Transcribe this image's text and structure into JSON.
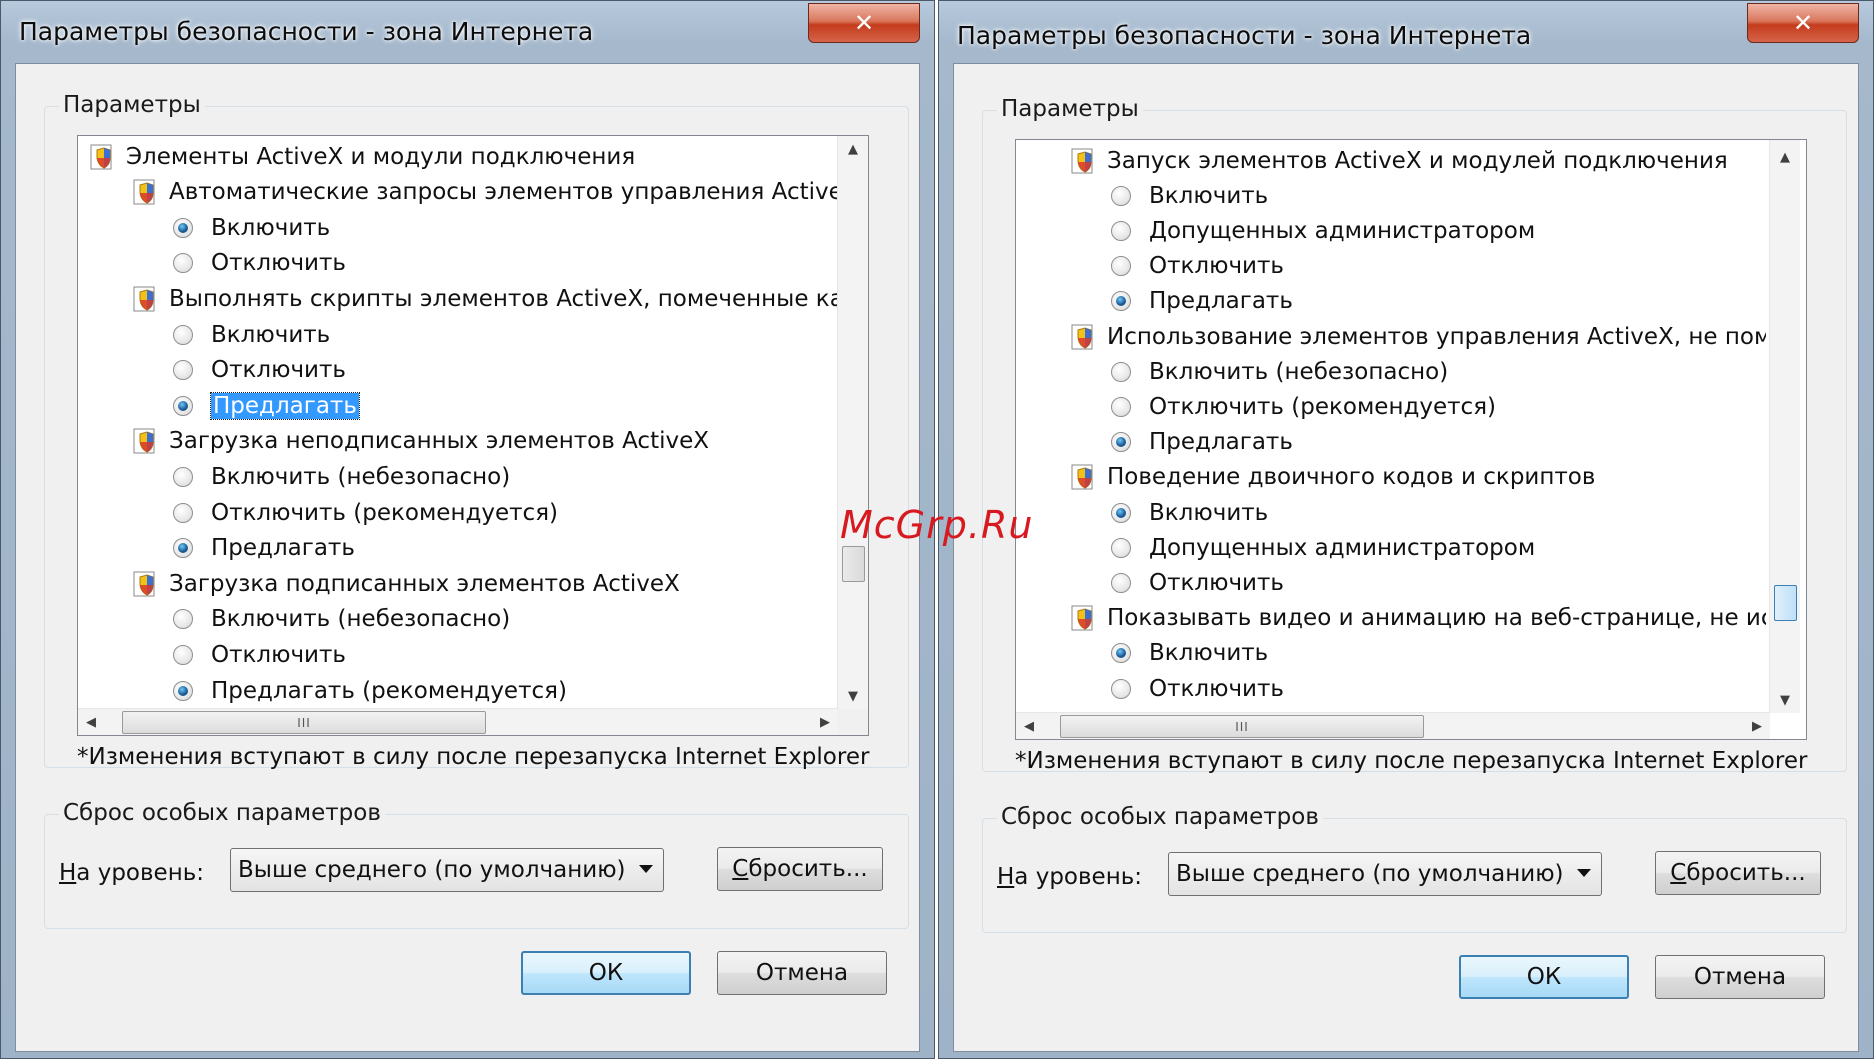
{
  "watermark": "McGrp.Ru",
  "dialogs": [
    {
      "title": "Параметры безопасности - зона Интернета",
      "close_label": "✕",
      "group_label": "Параметры",
      "tree_items": [
        {
          "kind": "header",
          "label": "Элементы ActiveX и модули подключения",
          "level": 0
        },
        {
          "kind": "header",
          "label": "Автоматические запросы элементов управления ActiveX",
          "level": 1
        },
        {
          "kind": "option",
          "label": "Включить",
          "checked": true
        },
        {
          "kind": "option",
          "label": "Отключить",
          "checked": false
        },
        {
          "kind": "header",
          "label": "Выполнять скрипты элементов ActiveX, помеченные как б",
          "level": 1
        },
        {
          "kind": "option",
          "label": "Включить",
          "checked": false
        },
        {
          "kind": "option",
          "label": "Отключить",
          "checked": false
        },
        {
          "kind": "option",
          "label": "Предлагать",
          "checked": true,
          "selected": true
        },
        {
          "kind": "header",
          "label": "Загрузка неподписанных элементов ActiveX",
          "level": 1
        },
        {
          "kind": "option",
          "label": "Включить (небезопасно)",
          "checked": false
        },
        {
          "kind": "option",
          "label": "Отключить (рекомендуется)",
          "checked": false
        },
        {
          "kind": "option",
          "label": "Предлагать",
          "checked": true
        },
        {
          "kind": "header",
          "label": "Загрузка подписанных элементов ActiveX",
          "level": 1
        },
        {
          "kind": "option",
          "label": "Включить (небезопасно)",
          "checked": false
        },
        {
          "kind": "option",
          "label": "Отключить",
          "checked": false
        },
        {
          "kind": "option",
          "label": "Предлагать (рекомендуется)",
          "checked": true
        }
      ],
      "hscroll_grip": "III",
      "note": "*Изменения вступают в силу после перезапуска Internet Explorer",
      "reset_group_label": "Сброс особых параметров",
      "level_label_mnemonic": "Н",
      "level_label_rest": "а уровень:",
      "level_value": "Выше среднего (по умолчанию)",
      "reset_button_mnemonic": "С",
      "reset_button_rest": "бросить...",
      "ok_label": "ОК",
      "cancel_label": "Отмена"
    },
    {
      "title": "Параметры безопасности - зона Интернета",
      "close_label": "✕",
      "group_label": "Параметры",
      "tree_items": [
        {
          "kind": "header",
          "label": "Запуск элементов ActiveX и модулей подключения",
          "level": 1
        },
        {
          "kind": "option",
          "label": "Включить",
          "checked": false
        },
        {
          "kind": "option",
          "label": "Допущенных администратором",
          "checked": false
        },
        {
          "kind": "option",
          "label": "Отключить",
          "checked": false
        },
        {
          "kind": "option",
          "label": "Предлагать",
          "checked": true
        },
        {
          "kind": "header",
          "label": "Использование элементов управления ActiveX, не помече",
          "level": 1
        },
        {
          "kind": "option",
          "label": "Включить (небезопасно)",
          "checked": false
        },
        {
          "kind": "option",
          "label": "Отключить (рекомендуется)",
          "checked": false
        },
        {
          "kind": "option",
          "label": "Предлагать",
          "checked": true
        },
        {
          "kind": "header",
          "label": "Поведение двоичного кодов и скриптов",
          "level": 1
        },
        {
          "kind": "option",
          "label": "Включить",
          "checked": true
        },
        {
          "kind": "option",
          "label": "Допущенных администратором",
          "checked": false
        },
        {
          "kind": "option",
          "label": "Отключить",
          "checked": false
        },
        {
          "kind": "header",
          "label": "Показывать видео и анимацию на веб-странице, не испо",
          "level": 1
        },
        {
          "kind": "option",
          "label": "Включить",
          "checked": true
        },
        {
          "kind": "option",
          "label": "Отключить",
          "checked": false
        }
      ],
      "hscroll_grip": "III",
      "note": "*Изменения вступают в силу после перезапуска Internet Explorer",
      "reset_group_label": "Сброс особых параметров",
      "level_label_mnemonic": "Н",
      "level_label_rest": "а уровень:",
      "level_value": "Выше среднего (по умолчанию)",
      "reset_button_mnemonic": "С",
      "reset_button_rest": "бросить...",
      "ok_label": "ОК",
      "cancel_label": "Отмена"
    }
  ]
}
